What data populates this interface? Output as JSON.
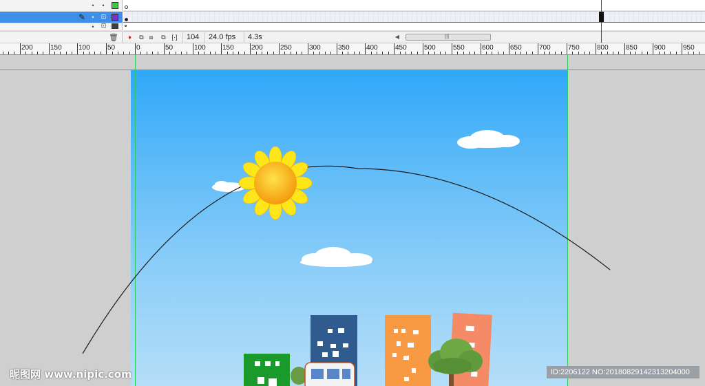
{
  "timeline": {
    "layers": [
      {
        "name": "",
        "selected": false,
        "box_color": "#3ec84a"
      },
      {
        "name": "",
        "selected": true,
        "box_color": "#7a30c8"
      },
      {
        "name": "",
        "selected": false,
        "box_color": "#404040"
      }
    ],
    "status": {
      "current_frame": "104",
      "frame_rate": "24.0 fps",
      "elapsed_time": "4.3s"
    }
  },
  "ruler": {
    "labels": [
      "200",
      "150",
      "100",
      "50",
      "0",
      "50",
      "100",
      "150",
      "200",
      "250",
      "300",
      "350",
      "400",
      "450",
      "500",
      "550",
      "600",
      "650",
      "700",
      "750",
      "800",
      "850",
      "900",
      "950"
    ]
  },
  "stage": {
    "sky_top_color": "#2fa8f8",
    "sky_bottom_color": "#b5def8",
    "guide_color": "#2ecb5a",
    "objects": [
      "sun",
      "clouds",
      "motion-path-arc",
      "buildings",
      "trees",
      "bus"
    ]
  },
  "watermark": {
    "left": "昵图网 www.nipic.com",
    "right": "ID:2206122 NO:20180829142313204000"
  },
  "colors": {
    "selected_layer": "#3f8ee8",
    "playhead": "#d01b1b",
    "sun_petals": "#ffe619",
    "sun_core": "#f9a60f",
    "building_green": "#1a9a2a",
    "building_blue": "#2f5b8f",
    "building_orange": "#f89a44",
    "building_salmon": "#f48a66",
    "tree_green": "#5f9a3c"
  }
}
